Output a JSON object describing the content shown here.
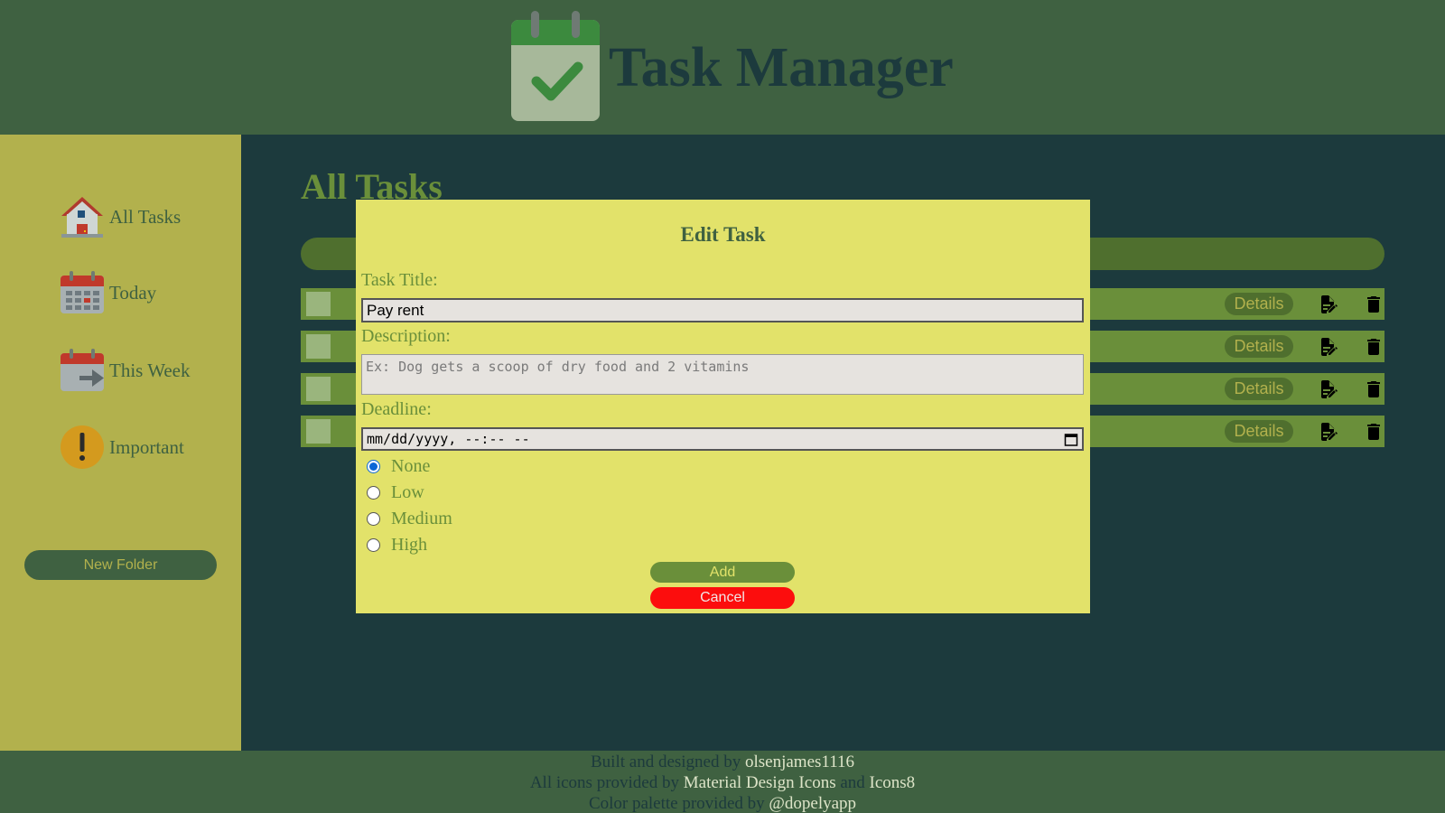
{
  "header": {
    "title": "Task Manager",
    "logo_icon": "calendar-check-icon"
  },
  "sidebar": {
    "items": [
      {
        "label": "All Tasks",
        "icon": "house-icon"
      },
      {
        "label": "Today",
        "icon": "calendar-today-icon"
      },
      {
        "label": "This Week",
        "icon": "calendar-arrow-icon"
      },
      {
        "label": "Important",
        "icon": "exclamation-icon"
      }
    ],
    "new_folder_label": "New Folder"
  },
  "main": {
    "title": "All Tasks",
    "tasks": [
      {
        "details_label": "Details"
      },
      {
        "details_label": "Details"
      },
      {
        "details_label": "Details"
      },
      {
        "details_label": "Details"
      }
    ]
  },
  "modal": {
    "title": "Edit Task",
    "task_title_label": "Task Title:",
    "task_title_value": "Pay rent",
    "description_label": "Description:",
    "description_placeholder": "Ex: Dog gets a scoop of dry food and 2 vitamins",
    "deadline_label": "Deadline:",
    "deadline_placeholder": "mm/dd/yyyy, --:-- --",
    "priorities": [
      {
        "label": "None",
        "checked": true
      },
      {
        "label": "Low",
        "checked": false
      },
      {
        "label": "Medium",
        "checked": false
      },
      {
        "label": "High",
        "checked": false
      }
    ],
    "add_label": "Add",
    "cancel_label": "Cancel"
  },
  "footer": {
    "line1_prefix": "Built and designed by ",
    "line1_link": "olsenjames1116",
    "line2_prefix": "All icons provided by ",
    "line2_link1": "Material Design Icons",
    "line2_and": " and ",
    "line2_link2": "Icons8",
    "line3_prefix": "Color palette provided by ",
    "line3_link": "@dopelyapp"
  },
  "colors": {
    "header_bg": "#3f6141",
    "sidebar_bg": "#b2b14d",
    "main_bg": "#1c3a3d",
    "modal_bg": "#e2e26a",
    "accent_green": "#6a8f3a",
    "cancel_red": "#fc0d0d",
    "radio_blue": "#0b66d6"
  }
}
